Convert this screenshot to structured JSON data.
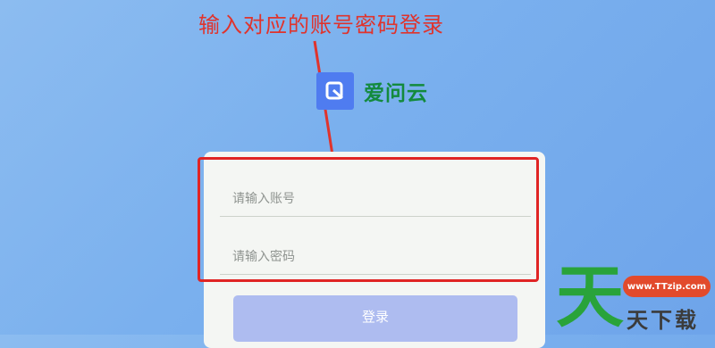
{
  "annotation": {
    "text": "输入对应的账号密码登录"
  },
  "logo": {
    "icon": "brand-logo-icon",
    "name": "爱问云",
    "brand_color": "#4f7cf0",
    "name_color": "#138a3d"
  },
  "login_form": {
    "account_placeholder": "请输入账号",
    "password_placeholder": "请输入密码",
    "submit_label": "登录",
    "button_color": "#aebcf0"
  },
  "watermark": {
    "big": "天",
    "site": "www.TTzip.com",
    "text": "天下载"
  },
  "colors": {
    "annotation": "#e0332c",
    "highlight": "#e02424",
    "background": "#7ab0ee"
  }
}
